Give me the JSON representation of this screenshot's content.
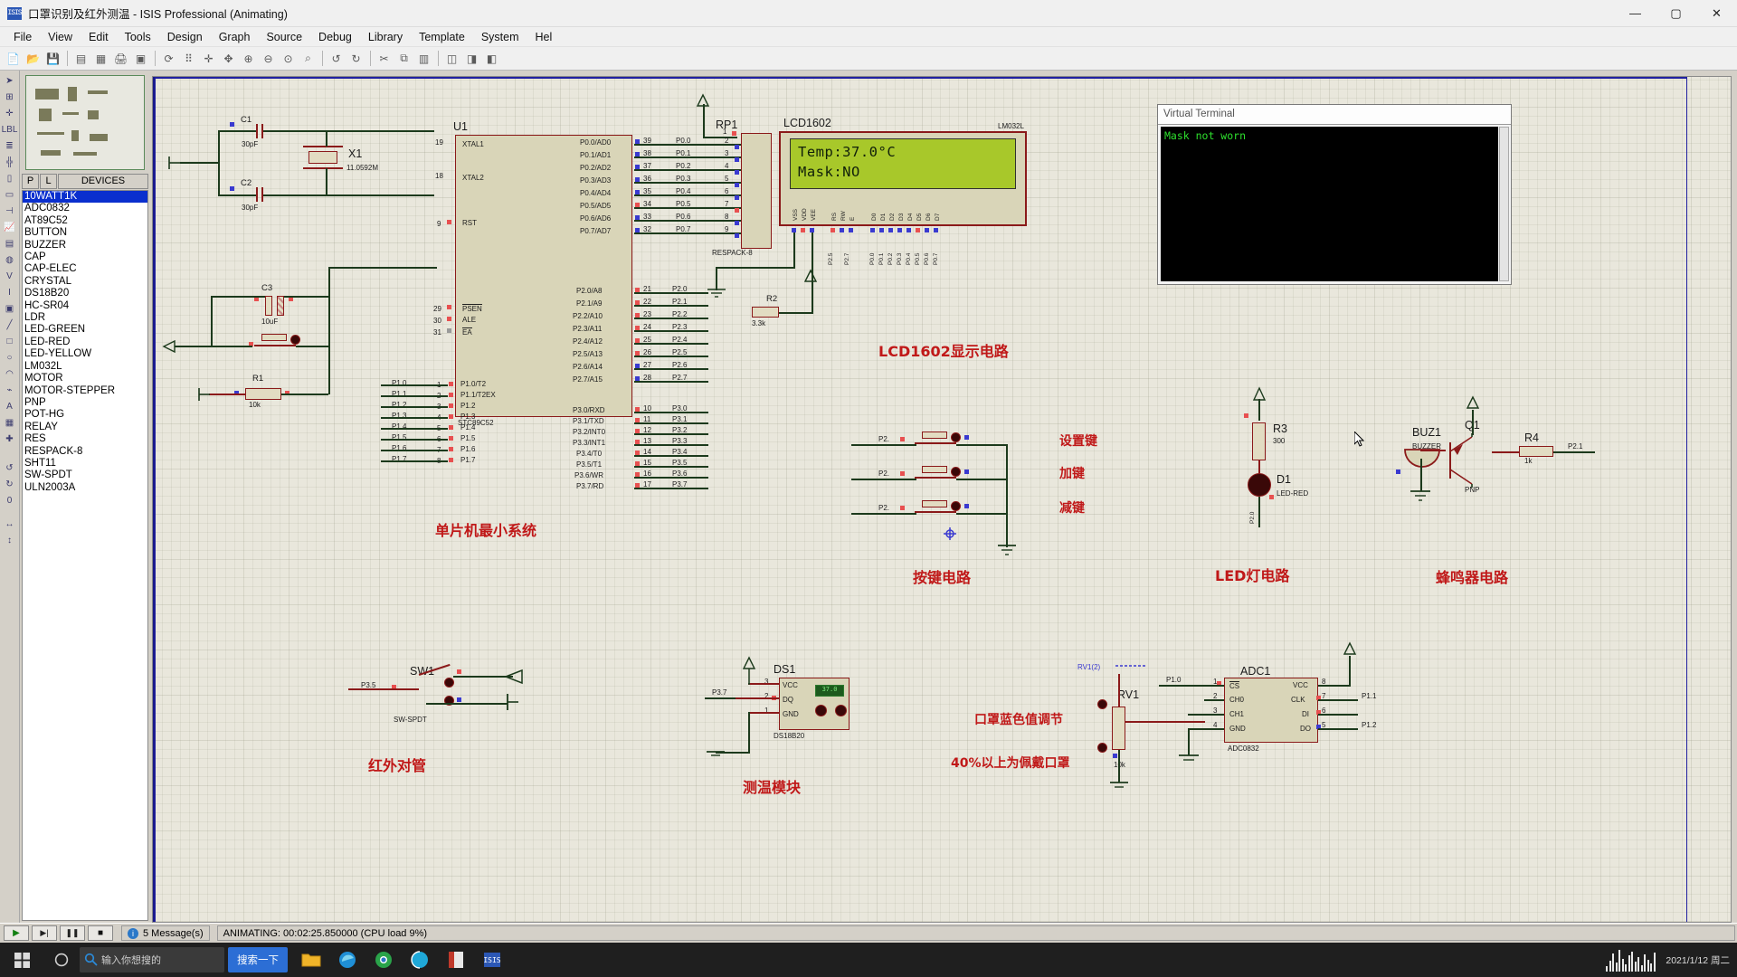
{
  "window": {
    "title": "口罩识别及红外测温 - ISIS Professional (Animating)",
    "logo_text": "ISIS",
    "minimize": "—",
    "maximize": "▢",
    "close": "✕"
  },
  "menubar": {
    "items": [
      "File",
      "View",
      "Edit",
      "Tools",
      "Design",
      "Graph",
      "Source",
      "Debug",
      "Library",
      "Template",
      "System",
      "Hel"
    ]
  },
  "toolbar": {
    "icons": [
      "new-file-icon",
      "open-folder-icon",
      "save-icon",
      "import-icon",
      "export-icon",
      "print-icon",
      "print-area-icon",
      "refresh-icon",
      "grid-icon",
      "origin-icon",
      "pan-icon",
      "zoom-in-icon",
      "zoom-out-icon",
      "zoom-all-icon",
      "zoom-area-icon",
      "undo-icon",
      "redo-icon",
      "cut-icon",
      "copy-icon",
      "paste-icon",
      "block-copy-icon",
      "block-move-icon",
      "block-delete-icon"
    ]
  },
  "toolstrip": {
    "icons": [
      "select-mode-icon",
      "component-mode-icon",
      "junction-dot-icon",
      "wire-label-icon",
      "text-script-icon",
      "bus-icon",
      "subcircuit-icon",
      "terminal-icon",
      "device-pin-icon",
      "graph-icon",
      "tape-recorder-icon",
      "generator-icon",
      "voltage-probe-icon",
      "current-probe-icon",
      "virtual-instrument-icon",
      "line-icon",
      "box-icon",
      "circle-icon",
      "arc-icon",
      "path-icon",
      "text-icon",
      "symbol-icon",
      "marker-icon",
      "rotate-cw-icon",
      "rotate-ccw-icon",
      "mirror-x-icon",
      "mirror-y-icon"
    ]
  },
  "sidebar": {
    "preview_label": "preview-pane",
    "header": {
      "p": "P",
      "l": "L",
      "title": "DEVICES"
    },
    "devices": [
      "10WATT1K",
      "ADC0832",
      "AT89C52",
      "BUTTON",
      "BUZZER",
      "CAP",
      "CAP-ELEC",
      "CRYSTAL",
      "DS18B20",
      "HC-SR04",
      "LDR",
      "LED-GREEN",
      "LED-RED",
      "LED-YELLOW",
      "LM032L",
      "MOTOR",
      "MOTOR-STEPPER",
      "PNP",
      "POT-HG",
      "RELAY",
      "RES",
      "RESPACK-8",
      "SHT11",
      "SW-SPDT",
      "ULN2003A"
    ],
    "selected_device": "10WATT1K"
  },
  "schematic": {
    "annotations": [
      {
        "text": "单片机最小系统",
        "meaning": "MCU minimum system"
      },
      {
        "text": "LCD1602显示电路",
        "meaning": "LCD1602 display circuit"
      },
      {
        "text": "按键电路",
        "meaning": "Key/button circuit"
      },
      {
        "text": "LED灯电路",
        "meaning": "LED light circuit"
      },
      {
        "text": "蜂鸣器电路",
        "meaning": "Buzzer circuit"
      },
      {
        "text": "红外对管",
        "meaning": "Infrared tube pair"
      },
      {
        "text": "测温模块",
        "meaning": "Temperature module"
      },
      {
        "text": "口罩蓝色值调节",
        "meaning": "Mask blue value adjustment"
      },
      {
        "text": "40%以上为佩戴口罩",
        "meaning": "Above 40% means mask worn"
      }
    ],
    "key_labels": [
      "设置键",
      "加键",
      "减键"
    ],
    "mcu": {
      "ref": "U1",
      "part": "STC89C52",
      "left_pins": [
        {
          "num": "19",
          "name": "XTAL1"
        },
        {
          "num": "18",
          "name": "XTAL2"
        },
        {
          "num": "9",
          "name": "RST"
        },
        {
          "num": "29",
          "name": "PSEN"
        },
        {
          "num": "30",
          "name": "ALE"
        },
        {
          "num": "31",
          "name": "EA"
        },
        {
          "num": "1",
          "name": "P1.0/T2"
        },
        {
          "num": "2",
          "name": "P1.1/T2EX"
        },
        {
          "num": "3",
          "name": "P1.2"
        },
        {
          "num": "4",
          "name": "P1.3"
        },
        {
          "num": "5",
          "name": "P1.4"
        },
        {
          "num": "6",
          "name": "P1.5"
        },
        {
          "num": "7",
          "name": "P1.6"
        },
        {
          "num": "8",
          "name": "P1.7"
        }
      ],
      "left_net_labels": [
        "P1.0",
        "P1.1",
        "P1.2",
        "P1.3",
        "P1.4",
        "P1.5",
        "P1.6",
        "P1.7"
      ],
      "right_pins_p0": [
        {
          "num": "39",
          "name": "P0.0/AD0",
          "net": "P0.0"
        },
        {
          "num": "38",
          "name": "P0.1/AD1",
          "net": "P0.1"
        },
        {
          "num": "37",
          "name": "P0.2/AD2",
          "net": "P0.2"
        },
        {
          "num": "36",
          "name": "P0.3/AD3",
          "net": "P0.3"
        },
        {
          "num": "35",
          "name": "P0.4/AD4",
          "net": "P0.4"
        },
        {
          "num": "34",
          "name": "P0.5/AD5",
          "net": "P0.5"
        },
        {
          "num": "33",
          "name": "P0.6/AD6",
          "net": "P0.6"
        },
        {
          "num": "32",
          "name": "P0.7/AD7",
          "net": "P0.7"
        }
      ],
      "right_pins_p2": [
        {
          "num": "21",
          "name": "P2.0/A8",
          "net": "P2.0"
        },
        {
          "num": "22",
          "name": "P2.1/A9",
          "net": "P2.1"
        },
        {
          "num": "23",
          "name": "P2.2/A10",
          "net": "P2.2"
        },
        {
          "num": "24",
          "name": "P2.3/A11",
          "net": "P2.3"
        },
        {
          "num": "25",
          "name": "P2.4/A12",
          "net": "P2.4"
        },
        {
          "num": "26",
          "name": "P2.5/A13",
          "net": "P2.5"
        },
        {
          "num": "27",
          "name": "P2.6/A14",
          "net": "P2.6"
        },
        {
          "num": "28",
          "name": "P2.7/A15",
          "net": "P2.7"
        }
      ],
      "right_pins_p3": [
        {
          "num": "10",
          "name": "P3.0/RXD",
          "net": "P3.0"
        },
        {
          "num": "11",
          "name": "P3.1/TXD",
          "net": "P3.1"
        },
        {
          "num": "12",
          "name": "P3.2/INT0",
          "net": "P3.2"
        },
        {
          "num": "13",
          "name": "P3.3/INT1",
          "net": "P3.3"
        },
        {
          "num": "14",
          "name": "P3.4/T0",
          "net": "P3.4"
        },
        {
          "num": "15",
          "name": "P3.5/T1",
          "net": "P3.5"
        },
        {
          "num": "16",
          "name": "P3.6/WR",
          "net": "P3.6"
        },
        {
          "num": "17",
          "name": "P3.7/RD",
          "net": "P3.7"
        }
      ]
    },
    "components": [
      {
        "ref": "C1",
        "value": "30pF"
      },
      {
        "ref": "C2",
        "value": "30pF"
      },
      {
        "ref": "C3",
        "value": "10uF"
      },
      {
        "ref": "X1",
        "value": "11.0592M"
      },
      {
        "ref": "R1",
        "value": "10k"
      },
      {
        "ref": "R2",
        "value": "3.3k"
      },
      {
        "ref": "R3",
        "value": "300"
      },
      {
        "ref": "R4",
        "value": "1k"
      },
      {
        "ref": "RP1",
        "value": "RESPACK-8"
      },
      {
        "ref": "D1",
        "value": "LED-RED"
      },
      {
        "ref": "BUZ1",
        "value": "BUZZER"
      },
      {
        "ref": "Q1",
        "value": "PNP"
      },
      {
        "ref": "SW1",
        "value": "SW-SPDT"
      },
      {
        "ref": "DS1",
        "value": "DS18B20"
      },
      {
        "ref": "RV1",
        "value": "10k"
      },
      {
        "ref": "ADC1",
        "value": "ADC0832"
      }
    ],
    "lcd": {
      "title": "LCD1602",
      "part": "LM032L",
      "line1": "Temp:37.0°C",
      "line2": "Mask:NO",
      "pins": [
        "VSS",
        "VDD",
        "VEE",
        "RS",
        "RW",
        "E",
        "D0",
        "D1",
        "D2",
        "D3",
        "D4",
        "D5",
        "D6",
        "D7"
      ],
      "net_labels": [
        "P2.5",
        "P2.7",
        "P0.0",
        "P0.1",
        "P0.2",
        "P0.3",
        "P0.4",
        "P0.5",
        "P0.6",
        "P0.7"
      ]
    },
    "terminal": {
      "title": "Virtual Terminal",
      "line1": "Mask not worn"
    },
    "ds18b20": {
      "ref": "DS1",
      "part": "DS18B20",
      "pins": [
        {
          "num": "3",
          "name": "VCC"
        },
        {
          "num": "2",
          "name": "DQ"
        },
        {
          "num": "1",
          "name": "GND"
        }
      ],
      "net": "P3.7",
      "display": "37.0"
    },
    "adc": {
      "ref": "ADC1",
      "part": "ADC0832",
      "left_pins": [
        {
          "num": "1",
          "name": "CS"
        },
        {
          "num": "2",
          "name": "CH0"
        },
        {
          "num": "3",
          "name": "CH1"
        },
        {
          "num": "4",
          "name": "GND"
        }
      ],
      "right_pins": [
        {
          "num": "8",
          "name": "VCC"
        },
        {
          "num": "7",
          "name": "CLK"
        },
        {
          "num": "6",
          "name": "DI"
        },
        {
          "num": "5",
          "name": "DO"
        }
      ],
      "net_left": "P1.0",
      "net_right_top": "P1.1",
      "net_right_bot": "P1.2"
    },
    "pot": {
      "ref": "RV1",
      "value": "10k",
      "wiper_label": "RV1(2)"
    },
    "sw1": {
      "ref": "SW1",
      "part": "SW-SPDT",
      "net": "P3.5"
    },
    "led": {
      "ref": "D1",
      "part": "LED-RED",
      "net": "P2.0",
      "resistor": "R3",
      "resistor_value": "300"
    },
    "buzzer": {
      "ref": "BUZ1",
      "part": "BUZZER",
      "transistor": "Q1",
      "transistor_type": "PNP",
      "resistor": "R4",
      "resistor_value": "1k",
      "net": "P2.1"
    },
    "keys": {
      "nets": [
        "P2.",
        "P2.",
        "P2."
      ]
    },
    "r2": {
      "ref": "R2",
      "value": "3.3k"
    }
  },
  "statusbar": {
    "play": "▶",
    "step": "▶|",
    "pause": "❚❚",
    "stop": "■",
    "messages": "5 Message(s)",
    "animating": "ANIMATING: 00:02:25.850000 (CPU load 9%)",
    "info_icon": "info-icon"
  },
  "taskbar": {
    "start": "start-icon",
    "search_icon": "search-icon",
    "search_placeholder": "输入你想搜的",
    "search_pill": "搜索一下",
    "apps": [
      "file-explorer-icon",
      "edge-icon",
      "chrome-icon",
      "browser-icon",
      "word-icon",
      "isis-icon"
    ],
    "clock": "2021/1/12 周二"
  },
  "colors": {
    "accent_red": "#c01818",
    "wire_green": "#1c3a1c",
    "wire_red": "#8b1a1a",
    "lcd_green": "#a8c82a",
    "terminal_green": "#2ee02e",
    "canvas_bg": "#e9e7dc",
    "select_blue": "#0a2fce"
  }
}
